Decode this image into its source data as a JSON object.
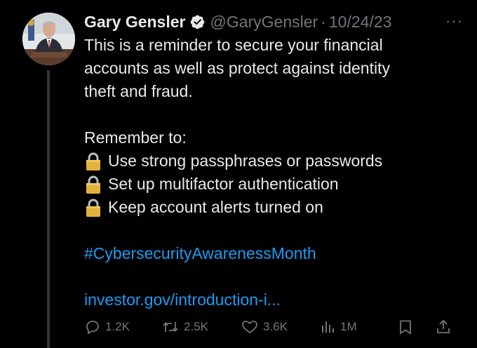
{
  "author": {
    "name": "Gary Gensler",
    "handle": "@GaryGensler",
    "separator": "·",
    "date": "10/24/23",
    "verified_color": "#e7e9ea"
  },
  "more_label": "···",
  "tweet": {
    "intro_lines": [
      "This is a reminder to secure your financial",
      "accounts as well as protect against identity",
      "theft and fraud."
    ],
    "remember": "Remember to:",
    "items": [
      "Use strong passphrases or passwords",
      "Set up multifactor authentication",
      "Keep account alerts turned on"
    ],
    "hashtag": "#CybersecurityAwarenessMonth",
    "link": "investor.gov/introduction-i..."
  },
  "actions": {
    "replies": "1.2K",
    "reposts": "2.5K",
    "likes": "3.6K",
    "views": "1M"
  },
  "icons": [
    "verified-icon",
    "lock-icon",
    "more-icon",
    "reply-icon",
    "repost-icon",
    "like-icon",
    "views-icon",
    "bookmark-icon",
    "share-icon"
  ],
  "colors": {
    "background": "#000000",
    "text": "#e7e9ea",
    "muted": "#71767b",
    "link": "#1d9bf0"
  }
}
